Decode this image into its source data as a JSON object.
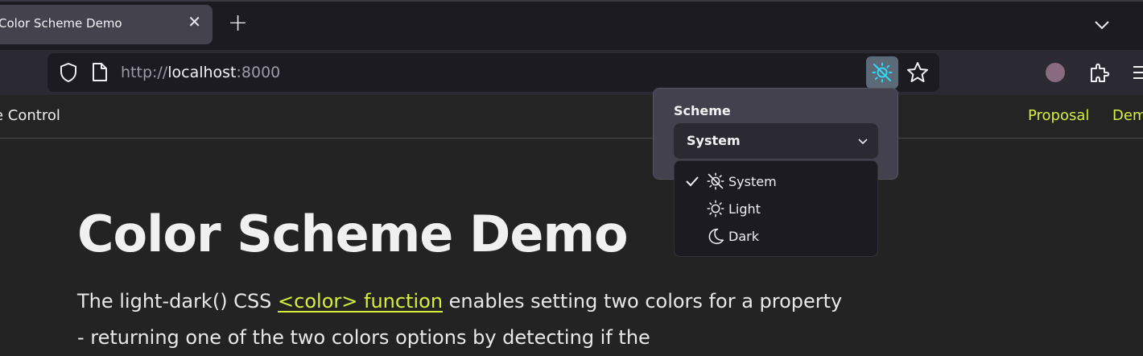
{
  "browser": {
    "tab_title": "Color Scheme Demo",
    "url_scheme": "http://",
    "url_host": "localhost",
    "url_port": ":8000"
  },
  "site_nav": {
    "site_name": "e Control",
    "links": [
      "Proposal",
      "Dem"
    ]
  },
  "page": {
    "heading": "Color Scheme Demo",
    "para_before": "The light-dark() CSS ",
    "para_link": "<color> function",
    "para_after": " enables setting two colors for a property - returning one of the two colors options by detecting if the"
  },
  "scheme_popup": {
    "label": "Scheme",
    "selected": "System",
    "options": [
      "System",
      "Light",
      "Dark"
    ]
  },
  "colors": {
    "accent": "#d5ef3a",
    "background": "#232323",
    "chrome": "#2b2a33"
  }
}
